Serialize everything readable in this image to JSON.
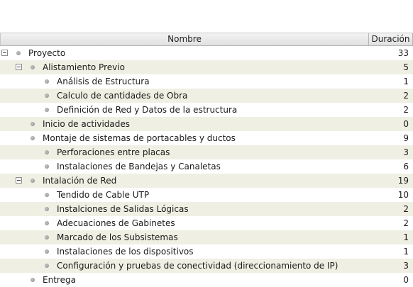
{
  "columns": {
    "name": "Nombre",
    "duration": "Duración"
  },
  "icons": {
    "expander": "minus-box-icon",
    "bullet": "bullet-icon"
  },
  "rows": [
    {
      "name": "Proyecto",
      "duration": "33",
      "level": 0,
      "expanded": true
    },
    {
      "name": "Alistamiento Previo",
      "duration": "5",
      "level": 1,
      "expanded": true
    },
    {
      "name": "Análisis de Estructura",
      "duration": "1",
      "level": 2
    },
    {
      "name": "Calculo de cantidades de Obra",
      "duration": "2",
      "level": 2
    },
    {
      "name": "Definición de Red y Datos de la estructura",
      "duration": "2",
      "level": 2
    },
    {
      "name": "Inicio de actividades",
      "duration": "0",
      "level": 1
    },
    {
      "name": "Montaje de sistemas de portacables y ductos",
      "duration": "9",
      "level": 1
    },
    {
      "name": "Perforaciones entre placas",
      "duration": "3",
      "level": 2
    },
    {
      "name": "Instalaciones de Bandejas y Canaletas",
      "duration": "6",
      "level": 2
    },
    {
      "name": "Intalación de Red",
      "duration": "19",
      "level": 1,
      "expanded": true
    },
    {
      "name": "Tendido de Cable UTP",
      "duration": "10",
      "level": 2
    },
    {
      "name": "Instalciones de Salidas Lógicas",
      "duration": "2",
      "level": 2
    },
    {
      "name": "Adecuaciones de Gabinetes",
      "duration": "2",
      "level": 2
    },
    {
      "name": "Marcado de los Subsistemas",
      "duration": "1",
      "level": 2
    },
    {
      "name": "Instalaciones de los dispositivos",
      "duration": "1",
      "level": 2
    },
    {
      "name": "Configuración y pruebas de conectividad (direccionamiento de IP)",
      "duration": "3",
      "level": 2
    },
    {
      "name": "Entrega",
      "duration": "0",
      "level": 1
    }
  ]
}
